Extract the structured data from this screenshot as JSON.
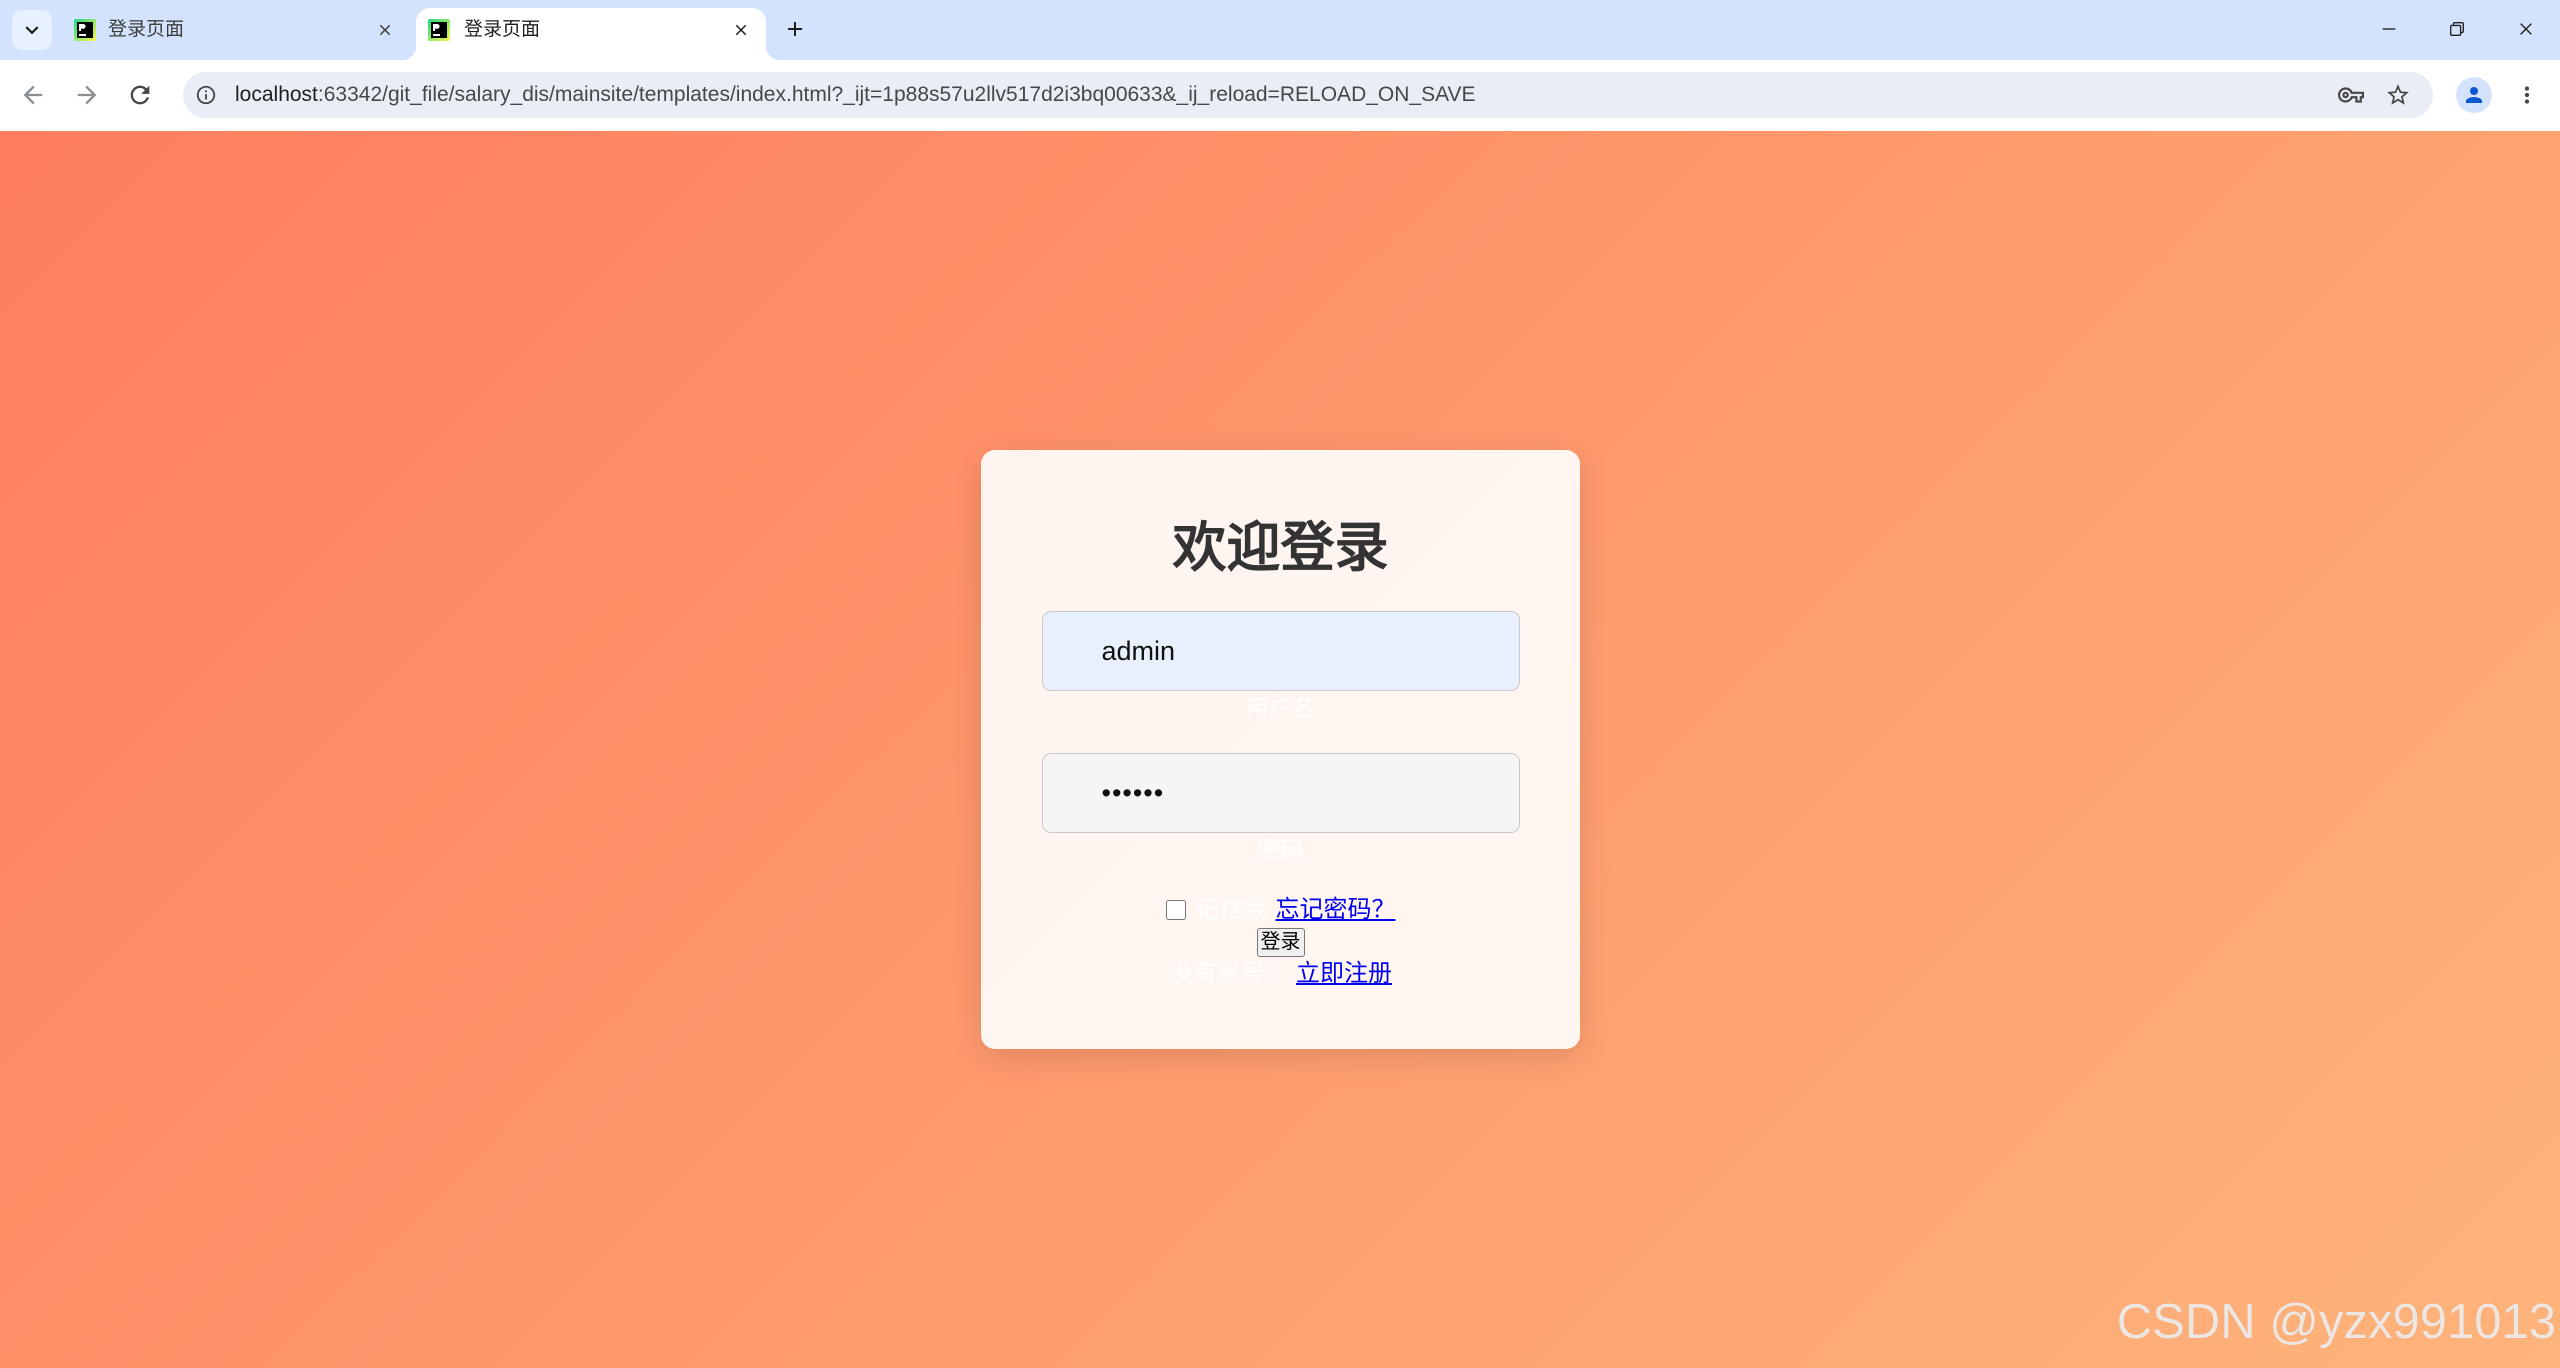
{
  "browser": {
    "tabs": [
      {
        "title": "登录页面",
        "active": false
      },
      {
        "title": "登录页面",
        "active": true
      }
    ],
    "address_bar": {
      "host": "localhost",
      "path": ":63342/git_file/salary_dis/mainsite/templates/index.html?_ijt=1p88s57u2llv517d2i3bq00633&_ij_reload=RELOAD_ON_SAVE"
    },
    "icons": {
      "tab_search": "chevron-down-icon",
      "favicon": "pycharm-favicon-icon",
      "tab_close": "close-icon",
      "new_tab": "plus-icon",
      "minimize": "minimize-icon",
      "restore": "restore-icon",
      "close_window": "close-icon",
      "back": "arrow-left-icon",
      "forward": "arrow-right-icon",
      "reload": "reload-icon",
      "site_info": "info-icon",
      "passwords": "key-icon",
      "bookmark": "star-icon",
      "profile": "person-icon",
      "menu": "more-vert-icon"
    },
    "colors": {
      "tabstrip": "#d3e3fd",
      "toolbar": "#ffffff",
      "omnibox": "#e9eef6",
      "profile_accent": "#0b57d0"
    }
  },
  "page": {
    "background": {
      "from": "#ff7e5f",
      "to": "#feb47b"
    },
    "login": {
      "title": "欢迎登录",
      "username": {
        "value": "admin",
        "label": "用户名"
      },
      "password": {
        "value": "••••••",
        "label": "密码"
      },
      "remember": {
        "label": "记住我",
        "checked": false
      },
      "forgot_link": "忘记密码？",
      "submit_label": "登录",
      "no_account_text": "没有账号？",
      "register_link": "立即注册"
    },
    "watermark": "CSDN @yzx991013"
  }
}
